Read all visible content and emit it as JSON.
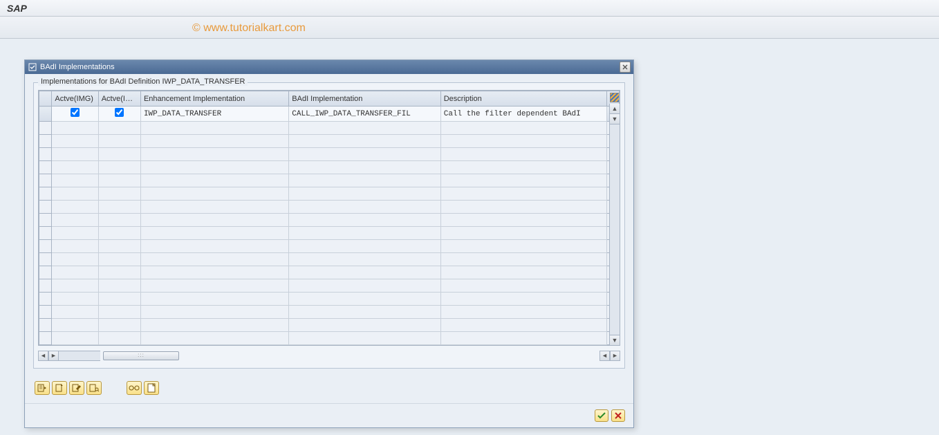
{
  "app": {
    "title": "SAP"
  },
  "watermark": "© www.tutorialkart.com",
  "dialog": {
    "title": "BAdI Implementations",
    "group_title": "Implementations for BAdI Definition IWP_DATA_TRANSFER",
    "columns": {
      "active_img": "Actve(IMG)",
      "active_im": "Actve(Im...",
      "enhancement": "Enhancement Implementation",
      "badi_impl": "BAdI Implementation",
      "description": "Description"
    },
    "rows": [
      {
        "active_img": true,
        "active_im": true,
        "enhancement": "IWP_DATA_TRANSFER",
        "badi_impl": "CALL_IWP_DATA_TRANSFER_FIL",
        "description": "Call the filter dependent BAdI"
      }
    ],
    "empty_row_count": 17
  },
  "buttons": {
    "b1": "implementation-overview",
    "b2": "create-implementation",
    "b3": "change-implementation",
    "b4": "display-implementation",
    "b5": "glasses-display",
    "b6": "new-entry"
  }
}
